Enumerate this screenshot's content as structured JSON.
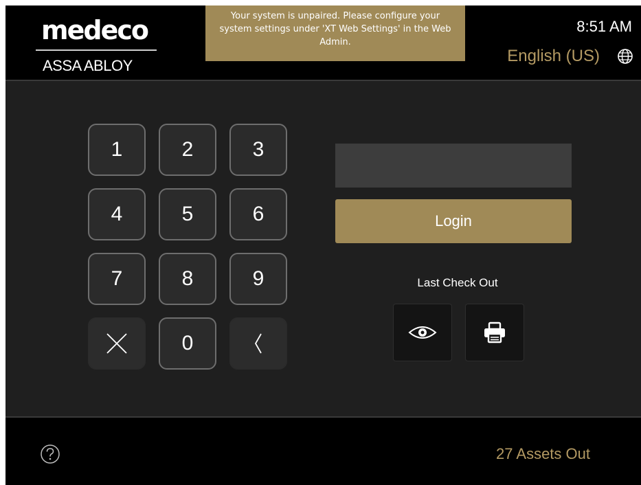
{
  "brand": {
    "logo_name": "medeco",
    "company": "ASSA ABLOY"
  },
  "banner": {
    "message": "Your system is unpaired. Please configure your system settings under 'XT Web Settings' in the Web Admin."
  },
  "status": {
    "time": "8:51 AM",
    "language": "English (US)"
  },
  "keypad": {
    "keys": [
      "1",
      "2",
      "3",
      "4",
      "5",
      "6",
      "7",
      "8",
      "9",
      "0"
    ]
  },
  "login": {
    "pin_value": "",
    "button_label": "Login"
  },
  "last_check_out": {
    "label": "Last Check Out",
    "icons": [
      "eye-icon",
      "printer-icon"
    ]
  },
  "footer": {
    "assets_out": "27 Assets Out"
  },
  "colors": {
    "accent_gold": "#a08a57",
    "gold_text": "#b49a63",
    "background": "#1f1f1f",
    "header_bg": "#000000"
  }
}
